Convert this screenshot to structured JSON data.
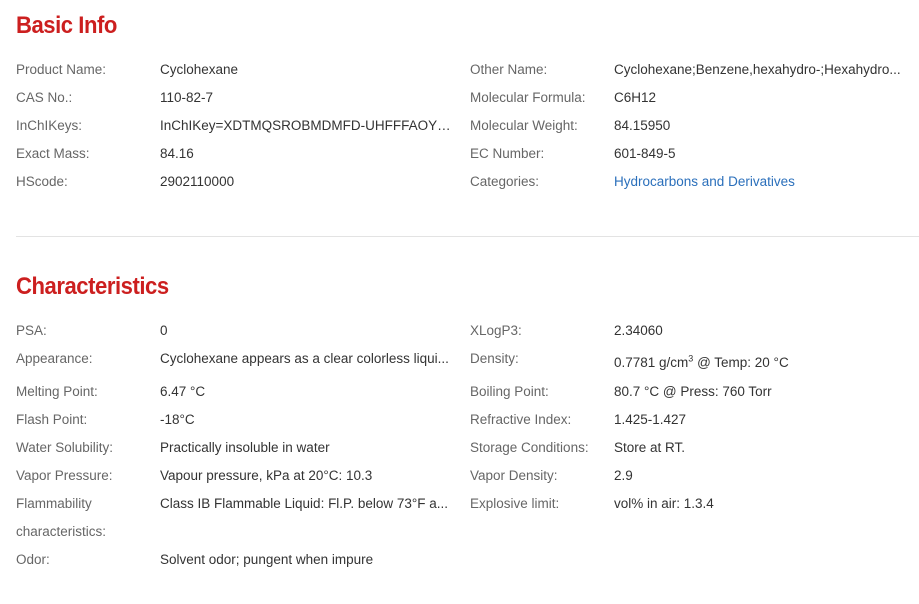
{
  "basic_info": {
    "title": "Basic Info",
    "left": [
      {
        "label": "Product Name:",
        "value": "Cyclohexane"
      },
      {
        "label": "CAS No.:",
        "value": "110-82-7"
      },
      {
        "label": "InChIKeys:",
        "value": "InChIKey=XDTMQSROBMDMFD-UHFFFAOYS..."
      },
      {
        "label": "Exact Mass:",
        "value": "84.16"
      },
      {
        "label": "HScode:",
        "value": "2902110000"
      }
    ],
    "right": [
      {
        "label": "Other Name:",
        "value": "Cyclohexane;Benzene,hexahydro-;Hexahydro..."
      },
      {
        "label": "Molecular Formula:",
        "value": "C6H12"
      },
      {
        "label": "Molecular Weight:",
        "value": "84.15950"
      },
      {
        "label": "EC Number:",
        "value": "601-849-5"
      },
      {
        "label": "Categories:",
        "value": "Hydrocarbons and Derivatives"
      }
    ]
  },
  "characteristics": {
    "title": "Characteristics",
    "left": [
      {
        "label": "PSA:",
        "value": "0"
      },
      {
        "label": "Appearance:",
        "value": "Cyclohexane appears as a clear colorless liqui..."
      },
      {
        "label": "Melting Point:",
        "value": "6.47 °C"
      },
      {
        "label": "Flash Point:",
        "value": "-18°C"
      },
      {
        "label": "Water Solubility:",
        "value": "Practically insoluble in water"
      },
      {
        "label": "Vapor Pressure:",
        "value": "Vapour pressure, kPa at 20°C: 10.3"
      },
      {
        "label_line1": "Flammability",
        "label_line2": "characteristics:",
        "value": "Class IB Flammable Liquid: Fl.P. below 73°F a..."
      },
      {
        "label": "Odor:",
        "value": "Solvent odor; pungent when impure"
      }
    ],
    "right": [
      {
        "label": "XLogP3:",
        "value": "2.34060"
      },
      {
        "label": "Density:",
        "value_main": "0.7781 g/cm",
        "value_sup": "3",
        "value_tail": " @ Temp: 20 °C"
      },
      {
        "label": "Boiling Point:",
        "value": "80.7 °C @ Press: 760 Torr"
      },
      {
        "label": "Refractive Index:",
        "value": "1.425-1.427"
      },
      {
        "label": "Storage Conditions:",
        "value": "Store at RT."
      },
      {
        "label": "Vapor Density:",
        "value": "2.9"
      },
      {
        "label": "Explosive limit:",
        "value": "vol% in air: 1.3.4"
      }
    ]
  },
  "colors": {
    "heading": "#cc1f1f",
    "label": "#666666",
    "value": "#333333",
    "link": "#2a6fbb",
    "divider": "#e3e3e3"
  }
}
